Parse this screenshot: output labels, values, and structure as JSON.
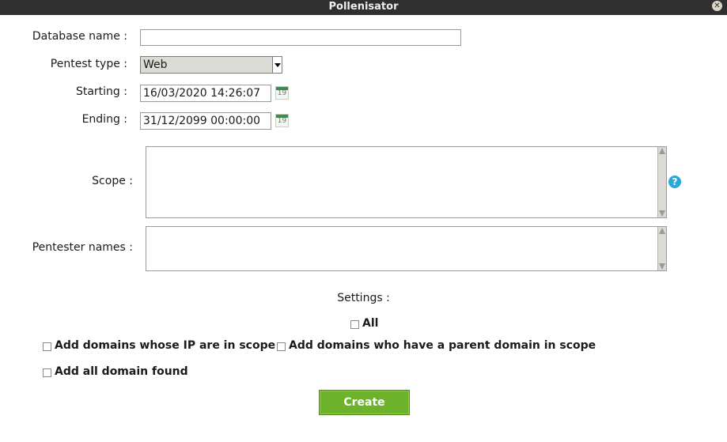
{
  "window": {
    "title": "Pollenisator"
  },
  "form": {
    "database_name": {
      "label": "Database name :",
      "value": ""
    },
    "pentest_type": {
      "label": "Pentest type :",
      "value": "Web"
    },
    "starting": {
      "label": "Starting :",
      "value": "16/03/2020 14:26:07"
    },
    "ending": {
      "label": "Ending :",
      "value": "31/12/2099 00:00:00"
    },
    "calendar_day": "19",
    "scope": {
      "label": "Scope :",
      "value": ""
    },
    "help_icon_glyph": "?",
    "pentester_names": {
      "label": "Pentester names :",
      "value": ""
    }
  },
  "settings": {
    "title": "Settings :",
    "all_label": "All",
    "options": [
      {
        "label": "Add domains whose IP are in scope",
        "checked": false
      },
      {
        "label": "Add domains who have a parent domain in scope",
        "checked": false
      },
      {
        "label": "Add all domain found",
        "checked": false
      }
    ]
  },
  "actions": {
    "create_label": "Create"
  },
  "colors": {
    "titlebar": "#2f2f2f",
    "create_button": "#6cb22a",
    "help_icon": "#26a8d8"
  }
}
